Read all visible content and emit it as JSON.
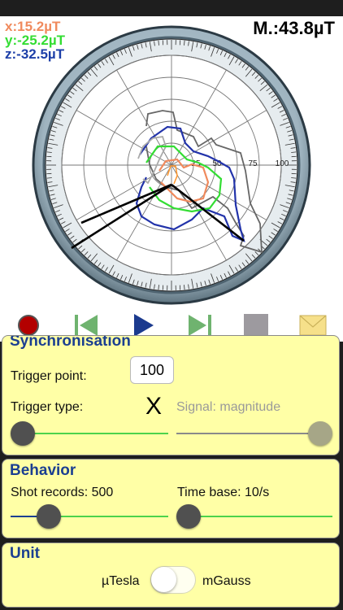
{
  "readouts": {
    "x": "x:15.2µT",
    "y": "y:-25.2µT",
    "z": "z:-32.5µT",
    "magnitude": "M.:43.8µT"
  },
  "polar_plot": {
    "ring_labels": [
      "25",
      "50",
      "75",
      "100"
    ]
  },
  "toolbar": {
    "icons": [
      "record-icon",
      "skip-back-icon",
      "play-icon",
      "skip-forward-icon",
      "stop-icon",
      "mail-icon"
    ]
  },
  "synchronisation": {
    "title": "Synchronisation",
    "trigger_point_label": "Trigger point:",
    "trigger_point_value": "100",
    "trigger_type_label": "Trigger type:",
    "trigger_type_mark": "X",
    "signal_label": "Signal: magnitude",
    "trigger_slider_level": 0
  },
  "behavior": {
    "title": "Behavior",
    "shot_records_label": "Shot records: 500",
    "time_base_label": "Time base: 10/s",
    "shot_records_slider_level": 0.25,
    "time_base_slider_level": 0
  },
  "unit": {
    "title": "Unit",
    "left_label": "µTesla",
    "right_label": "mGauss",
    "toggle_on": false
  },
  "colors": {
    "x": "#f08a5d",
    "y": "#33dd33",
    "z": "#1d3fa8",
    "panel_bg": "#ffffa6",
    "title": "#1b3f91",
    "slider_track": "#4cd34c"
  }
}
